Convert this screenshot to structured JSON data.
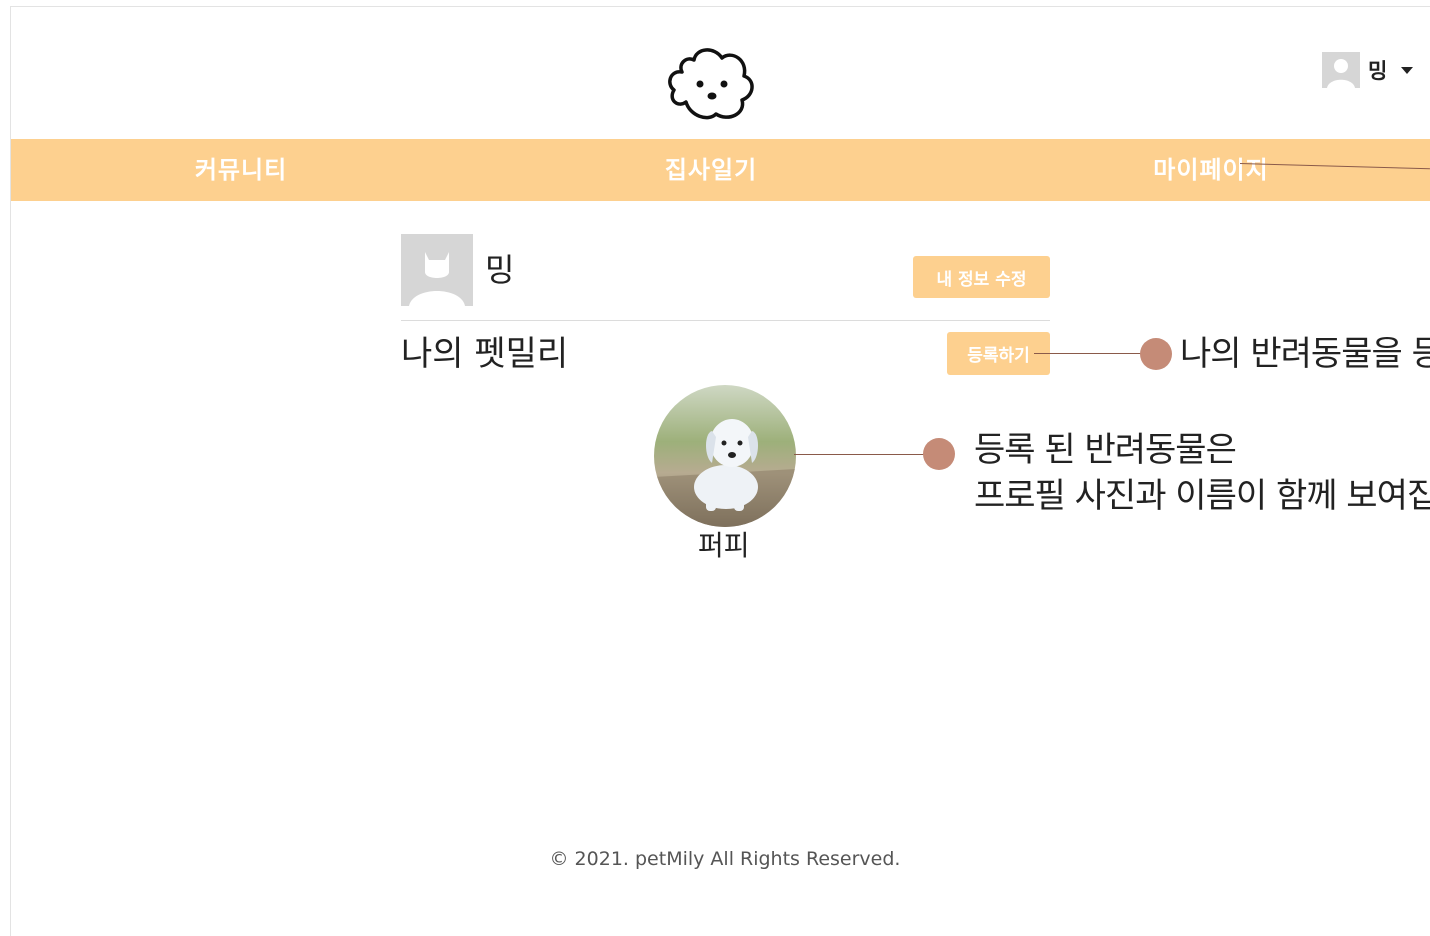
{
  "header": {
    "logo_icon": "dog-face-icon",
    "user": {
      "name": "밍",
      "avatar_icon": "default-avatar-icon"
    }
  },
  "nav": {
    "items": [
      {
        "label": "커뮤니티"
      },
      {
        "label": "집사일기"
      },
      {
        "label": "마이페이지"
      }
    ],
    "background": "#fdd08f"
  },
  "profile": {
    "name": "밍",
    "edit_button": "내 정보 수정"
  },
  "family": {
    "title": "나의 펫밀리",
    "register_button": "등록하기",
    "pets": [
      {
        "name": "퍼피"
      }
    ]
  },
  "annotations": {
    "register": "나의 반려동물을 등",
    "pet_line1": "등록 된 반려동물은",
    "pet_line2": "프로필 사진과 이름이 함께 보여집니"
  },
  "footer": {
    "copyright": "© 2021. petMily All Rights Reserved."
  },
  "colors": {
    "accent": "#fdd08f",
    "callout": "#c58b77"
  }
}
